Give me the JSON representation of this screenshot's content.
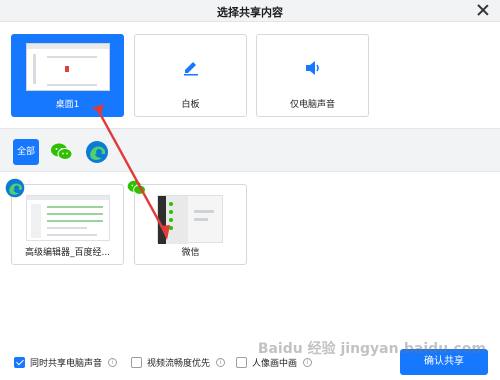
{
  "window": {
    "title": "选择共享内容"
  },
  "top_cards": [
    {
      "label": "桌面1",
      "selected": true
    },
    {
      "label": "白板",
      "selected": false
    },
    {
      "label": "仅电脑声音",
      "selected": false
    }
  ],
  "filter": {
    "all_label": "全部",
    "apps": [
      "wechat-icon",
      "edge-icon"
    ]
  },
  "windows": [
    {
      "label": "高级编辑器_百度经...",
      "app_icon": "edge-icon"
    },
    {
      "label": "微信",
      "app_icon": "wechat-icon"
    }
  ],
  "options": [
    {
      "label": "同时共享电脑声音",
      "checked": true
    },
    {
      "label": "视频流畅度优先",
      "checked": false
    },
    {
      "label": "人像画中画",
      "checked": false
    }
  ],
  "share_button": "确认共享",
  "watermark": "Baidu 经验 jingyan.baidu.com",
  "colors": {
    "accent": "#1677ff",
    "annotation_arrow": "#e03a3a"
  }
}
